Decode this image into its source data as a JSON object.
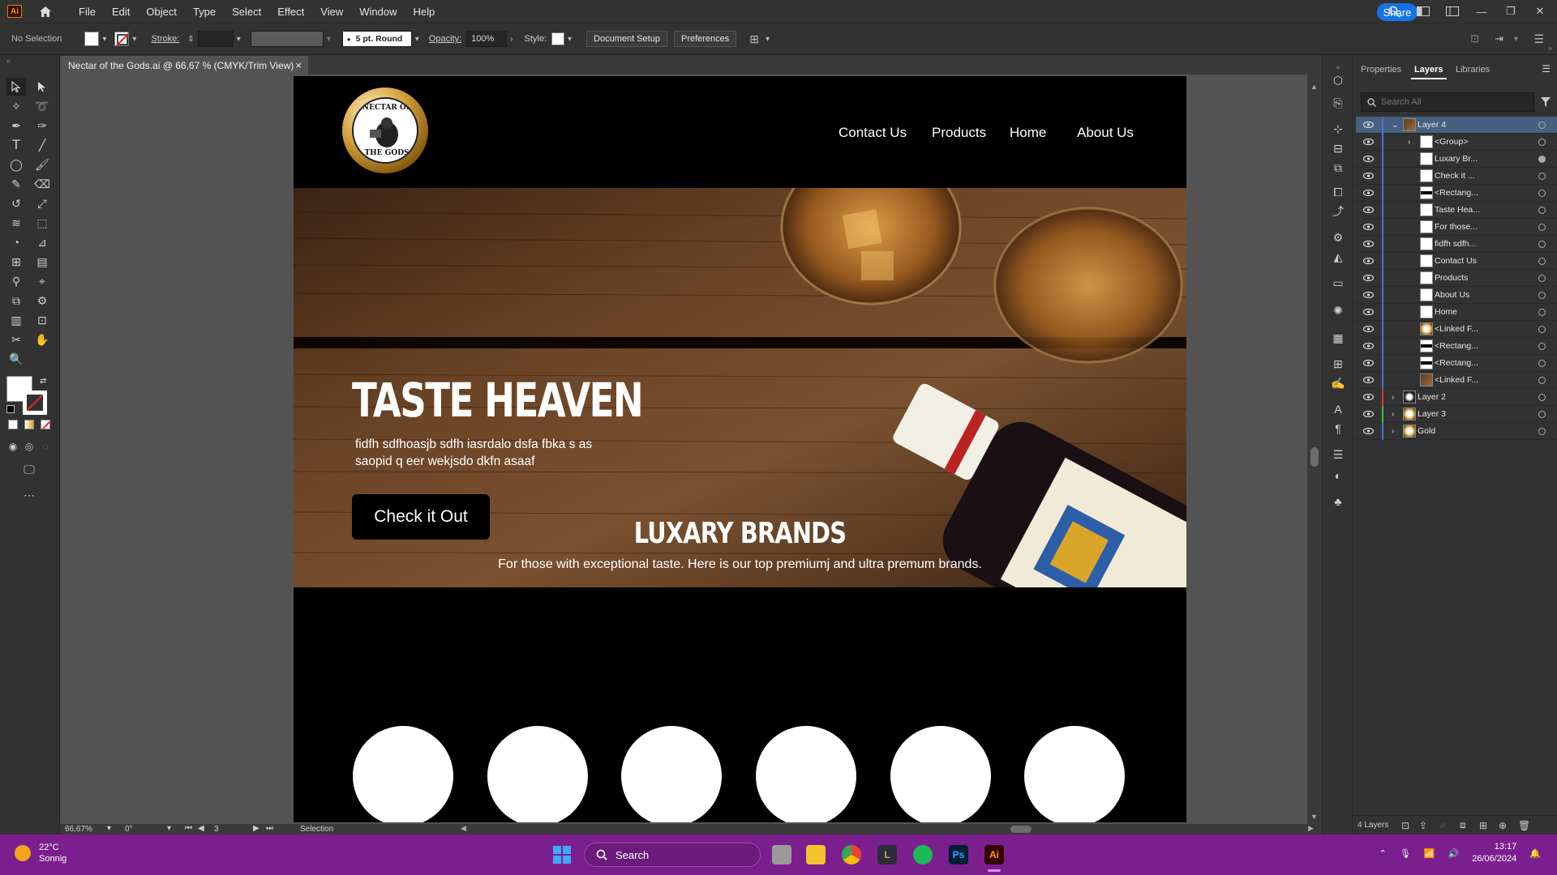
{
  "app": {
    "logo": "Ai",
    "menu": [
      "File",
      "Edit",
      "Object",
      "Type",
      "Select",
      "Effect",
      "View",
      "Window",
      "Help"
    ],
    "share": "Share"
  },
  "control_bar": {
    "selection": "No Selection",
    "stroke_label": "Stroke:",
    "brush": "5 pt. Round",
    "opacity_label": "Opacity:",
    "opacity": "100%",
    "style_label": "Style:",
    "doc_setup": "Document Setup",
    "preferences": "Preferences"
  },
  "document_tab": {
    "title": "Nectar of the Gods.ai @ 66,67 % (CMYK/Trim View)",
    "close": "×"
  },
  "artboard": {
    "logo_text_top": "NECTAR OF",
    "logo_text_bottom": "THE GODS",
    "nav": [
      "Contact Us",
      "Products",
      "Home",
      "About Us"
    ],
    "hero_title": "TASTE HEAVEN",
    "hero_body": "fidfh sdfhoasjb sdfh iasrdalo dsfa fbka s as saopid q eer  wekjsdo dkfn asaaf",
    "hero_button": "Check it Out",
    "section_title": "LUXARY BRANDS",
    "section_sub": "For those with exceptional taste. Here is our top premiumj and ultra premum brands."
  },
  "status_bar": {
    "zoom": "66,67%",
    "rotation": "0°",
    "artboard": "3",
    "mode": "Selection"
  },
  "panel": {
    "tabs": [
      "Properties",
      "Layers",
      "Libraries"
    ],
    "active_tab": "Layers",
    "search_placeholder": "Search All",
    "layers": [
      {
        "name": "Layer 4",
        "level": 0,
        "color": "#4f6bd8",
        "expanded": true,
        "selected": true,
        "thumb": "photo"
      },
      {
        "name": "<Group>",
        "level": 2,
        "color": "#4f6bd8",
        "chevron": true
      },
      {
        "name": "Luxary Br...",
        "level": 1,
        "color": "#4f6bd8",
        "filled": true
      },
      {
        "name": "Check it ...",
        "level": 1,
        "color": "#4f6bd8"
      },
      {
        "name": "<Rectang...",
        "level": 1,
        "color": "#4f6bd8",
        "thumb": "bar"
      },
      {
        "name": "Taste Hea...",
        "level": 1,
        "color": "#4f6bd8"
      },
      {
        "name": "For those...",
        "level": 1,
        "color": "#4f6bd8"
      },
      {
        "name": "fidfh sdfh...",
        "level": 1,
        "color": "#4f6bd8"
      },
      {
        "name": "Contact Us",
        "level": 1,
        "color": "#4f6bd8"
      },
      {
        "name": "Products",
        "level": 1,
        "color": "#4f6bd8"
      },
      {
        "name": "About Us",
        "level": 1,
        "color": "#4f6bd8"
      },
      {
        "name": "Home",
        "level": 1,
        "color": "#4f6bd8"
      },
      {
        "name": "<Linked F...",
        "level": 1,
        "color": "#4f6bd8",
        "thumb": "gold"
      },
      {
        "name": "<Rectang...",
        "level": 1,
        "color": "#4f6bd8",
        "thumb": "bar"
      },
      {
        "name": "<Rectang...",
        "level": 1,
        "color": "#4f6bd8",
        "thumb": "bar"
      },
      {
        "name": "<Linked F...",
        "level": 1,
        "color": "#4f6bd8",
        "thumb": "photo"
      },
      {
        "name": "Layer 2",
        "level": 0,
        "color": "#d43a3a",
        "thumb": "dark"
      },
      {
        "name": "Layer 3",
        "level": 0,
        "color": "#3ac43a",
        "thumb": "gold"
      },
      {
        "name": "Gold",
        "level": 0,
        "color": "#4f6bd8",
        "thumb": "gold"
      }
    ],
    "footer": "4 Layers"
  },
  "taskbar": {
    "temp": "22°C",
    "weather": "Sonnig",
    "search": "Search",
    "time": "13:17",
    "date": "26/06/2024",
    "ps": "Ps",
    "ai": "Ai"
  },
  "colors": {
    "accent": "#1473e6",
    "taskbar": "#7b1f8f",
    "selected_layer": "#46607f"
  }
}
